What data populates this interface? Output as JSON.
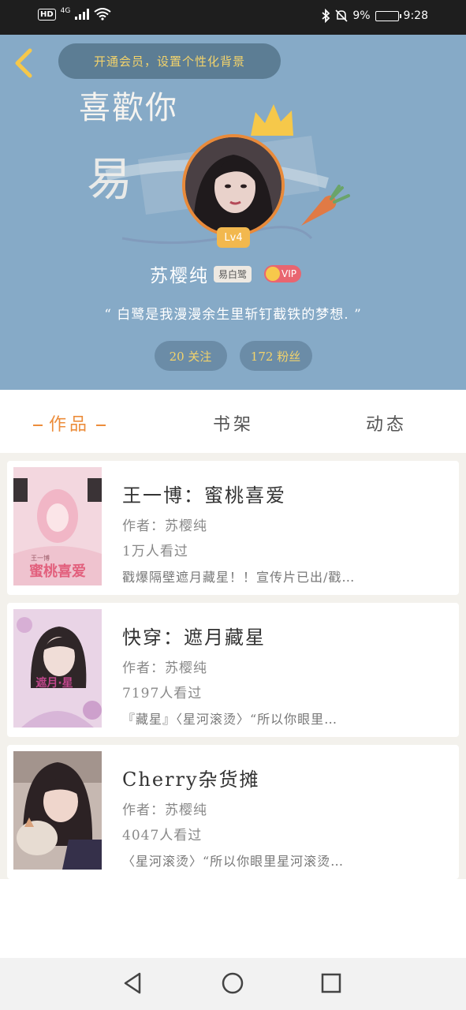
{
  "status_bar": {
    "network_badge": "HD",
    "network_type": "4G",
    "battery_percent": "9%",
    "time": "9:28",
    "icons": [
      "wifi-icon",
      "bluetooth-icon",
      "mute-icon",
      "battery-charging-icon"
    ]
  },
  "header": {
    "vip_prompt": "开通会员，设置个性化背景",
    "background_text": "喜歡你",
    "level": "Lv4",
    "username": "苏樱纯",
    "name_tag": "易白鹭",
    "vip_label": "VIP",
    "signature": "“ 白鹭是我漫漫余生里斩钉截铁的梦想. ”",
    "following": "20 关注",
    "followers": "172 粉丝",
    "colors": {
      "background": "#86aac7",
      "accent": "#f3d36b",
      "avatar_ring": "#e88a3a"
    }
  },
  "tabs": [
    {
      "label": "作品",
      "active": true
    },
    {
      "label": "书架",
      "active": false
    },
    {
      "label": "动态",
      "active": false
    }
  ],
  "tab_active_color": "#ec8d3b",
  "books": [
    {
      "title": "王一博：蜜桃喜爱",
      "author": "作者：苏樱纯",
      "views": "1万人看过",
      "description": "戳爆隔壁遮月藏星！！宣传片已出/戳…",
      "cover_text": "蜜桃喜爱",
      "cover_subtext": "王一博"
    },
    {
      "title": "快穿：遮月藏星",
      "author": "作者：苏樱纯",
      "views": "7197人看过",
      "description": "『藏星』〈星河滚烫〉“所以你眼里…",
      "cover_text": "遮月·星"
    },
    {
      "title": "Cherry杂货摊",
      "author": "作者：苏樱纯",
      "views": "4047人看过",
      "description": "〈星河滚烫〉“所以你眼里星河滚烫…"
    }
  ],
  "nav_bar": {
    "icons": [
      "back-triangle-icon",
      "home-circle-icon",
      "recents-square-icon"
    ]
  }
}
